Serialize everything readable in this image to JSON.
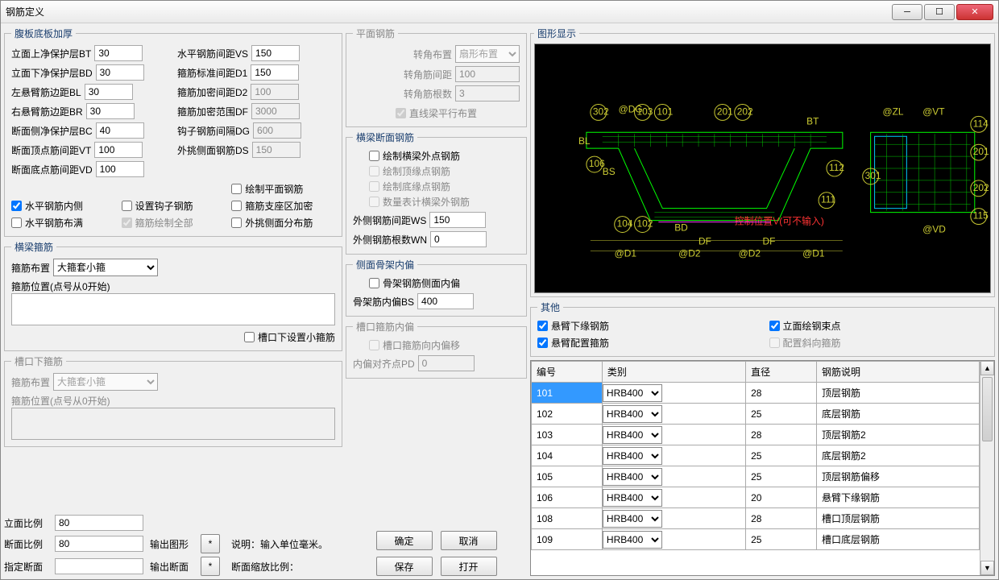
{
  "window": {
    "title": "钢筋定义"
  },
  "fubanjiahou": {
    "legend": "腹板底板加厚",
    "left": [
      {
        "label": "立面上净保护层BT",
        "val": "30"
      },
      {
        "label": "立面下净保护层BD",
        "val": "30"
      },
      {
        "label": "左悬臂筋边距BL",
        "val": "30"
      },
      {
        "label": "右悬臂筋边距BR",
        "val": "30"
      },
      {
        "label": "断面侧净保护层BC",
        "val": "40"
      },
      {
        "label": "断面顶点筋间距VT",
        "val": "100"
      },
      {
        "label": "断面底点筋间距VD",
        "val": "100"
      }
    ],
    "right": [
      {
        "label": "水平钢筋间距VS",
        "val": "150",
        "en": true
      },
      {
        "label": "箍筋标准间距D1",
        "val": "150",
        "en": true
      },
      {
        "label": "箍筋加密间距D2",
        "val": "100",
        "en": false
      },
      {
        "label": "箍筋加密范围DF",
        "val": "3000",
        "en": false
      },
      {
        "label": "钩子钢筋间隔DG",
        "val": "600",
        "en": false
      },
      {
        "label": "外挑侧面钢筋DS",
        "val": "150",
        "en": false
      }
    ],
    "checks": [
      {
        "label": "绘制平面钢筋",
        "chk": false,
        "en": true
      },
      {
        "label": "水平钢筋内侧",
        "chk": true,
        "en": true
      },
      {
        "label": "设置钩子钢筋",
        "chk": false,
        "en": true
      },
      {
        "label": "箍筋支座区加密",
        "chk": false,
        "en": true
      },
      {
        "label": "水平钢筋布满",
        "chk": false,
        "en": true
      },
      {
        "label": "箍筋绘制全部",
        "chk": true,
        "en": false
      },
      {
        "label": "外挑侧面分布筋",
        "chk": false,
        "en": true
      }
    ]
  },
  "hengliang_gu": {
    "legend": "横梁箍筋",
    "buzhi_label": "箍筋布置",
    "buzhi_value": "大箍套小箍",
    "pos_label": "箍筋位置(点号从0开始)",
    "slot_chk": "槽口下设置小箍筋"
  },
  "caokou_gu": {
    "legend": "槽口下箍筋",
    "buzhi_label": "箍筋布置",
    "buzhi_value": "大箍套小箍",
    "pos_label": "箍筋位置(点号从0开始)"
  },
  "bottom_left": {
    "l1": "立面比例",
    "v1": "80",
    "l2": "断面比例",
    "v2": "80",
    "l3": "指定断面",
    "v3": "",
    "out_graph": "输出图形",
    "star": "*",
    "out_section": "输出断面",
    "note_label": "说明：",
    "note_text": "输入单位毫米。",
    "scale_label": "断面缩放比例："
  },
  "pingmian": {
    "legend": "平面钢筋",
    "l1": "转角布置",
    "v1": "扇形布置",
    "l2": "转角筋间距",
    "v2": "100",
    "l3": "转角筋根数",
    "v3": "3",
    "chk": "直线梁平行布置"
  },
  "hengliang_sec": {
    "legend": "横梁断面钢筋",
    "checks": [
      {
        "label": "绘制横梁外点钢筋",
        "chk": false,
        "en": true
      },
      {
        "label": "绘制顶缘点钢筋",
        "chk": false,
        "en": false
      },
      {
        "label": "绘制底缘点钢筋",
        "chk": false,
        "en": false
      },
      {
        "label": "数量表计横梁外钢筋",
        "chk": false,
        "en": false
      }
    ],
    "ws_label": "外侧钢筋间距WS",
    "ws_val": "150",
    "wn_label": "外侧钢筋根数WN",
    "wn_val": "0"
  },
  "cemian": {
    "legend": "侧面骨架内偏",
    "chk": "骨架钢筋侧面内偏",
    "bs_label": "骨架筋内偏BS",
    "bs_val": "400"
  },
  "caokou_nei": {
    "legend": "槽口箍筋内偏",
    "chk": "槽口箍筋向内偏移",
    "pd_label": "内偏对齐点PD",
    "pd_val": "0"
  },
  "buttons": {
    "ok": "确定",
    "cancel": "取消",
    "save": "保存",
    "open": "打开"
  },
  "tuxing": {
    "legend": "图形显示"
  },
  "others": {
    "legend": "其他",
    "checks": [
      {
        "label": "悬臂下缘钢筋",
        "chk": true,
        "en": true
      },
      {
        "label": "立面绘钢束点",
        "chk": true,
        "en": true
      },
      {
        "label": "悬臂配置箍筋",
        "chk": true,
        "en": true
      },
      {
        "label": "配置斜向箍筋",
        "chk": false,
        "en": false
      }
    ]
  },
  "table": {
    "headers": [
      "编号",
      "类别",
      "直径",
      "钢筋说明"
    ],
    "rows": [
      {
        "id": "101",
        "type": "HRB400",
        "dia": "28",
        "desc": "顶层钢筋",
        "sel": true
      },
      {
        "id": "102",
        "type": "HRB400",
        "dia": "25",
        "desc": "底层钢筋"
      },
      {
        "id": "103",
        "type": "HRB400",
        "dia": "28",
        "desc": "顶层钢筋2"
      },
      {
        "id": "104",
        "type": "HRB400",
        "dia": "25",
        "desc": "底层钢筋2"
      },
      {
        "id": "105",
        "type": "HRB400",
        "dia": "25",
        "desc": "顶层钢筋偏移"
      },
      {
        "id": "106",
        "type": "HRB400",
        "dia": "20",
        "desc": "悬臂下缘钢筋"
      },
      {
        "id": "108",
        "type": "HRB400",
        "dia": "28",
        "desc": "槽口顶层钢筋"
      },
      {
        "id": "109",
        "type": "HRB400",
        "dia": "25",
        "desc": "槽口底层钢筋"
      }
    ]
  },
  "diagram_labels": {
    "bl": "BL",
    "bt": "BT",
    "bs": "BS",
    "bd": "BD",
    "df": "DF",
    "d1": "@D1",
    "d2": "@D2",
    "dg": "@DG",
    "zl": "@ZL",
    "vt": "@VT",
    "vd": "@VD",
    "ctrl": "控制位置V(可不输入)",
    "n302": "302",
    "n103": "103",
    "n101": "101",
    "n201": "201",
    "n202": "202",
    "n106": "106",
    "n112": "112",
    "n104": "104",
    "n102": "102",
    "n111": "111",
    "n114": "114",
    "n301": "301",
    "n115": "115",
    "n201b": "201",
    "n202b": "202"
  }
}
